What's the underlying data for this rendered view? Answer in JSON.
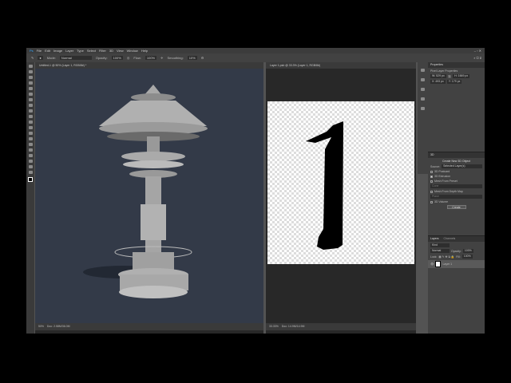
{
  "menu": [
    "File",
    "Edit",
    "Image",
    "Layer",
    "Type",
    "Select",
    "Filter",
    "3D",
    "View",
    "Window",
    "Help"
  ],
  "options": {
    "mode_label": "Mode:",
    "mode": "Normal",
    "opacity_label": "Opacity:",
    "opacity": "100%",
    "flow_label": "Flow:",
    "flow": "100%",
    "smoothing_label": "Smoothing:",
    "smoothing": "10%"
  },
  "doc1": {
    "tab": "Untitled-1 @ 50% (Layer 1, RGB/8#) *",
    "zoom": "50%",
    "doc_size": "Doc: 2.58M/36.0M"
  },
  "doc2": {
    "tab": "Layer 1.psb @ 33.3% (Layer 1, RGB/8#)",
    "zoom": "33.33%",
    "doc_size": "Doc: 14.9M/14.9M"
  },
  "properties": {
    "title": "Properties",
    "subtitle": "Pixel Layer Properties",
    "w": "W: 529 px",
    "h": "H: 1669 px",
    "x": "X: 493 px",
    "y": "Y: 179 px"
  },
  "three_d": {
    "title": "3D",
    "heading": "Create New 3D Object",
    "source_label": "Source:",
    "source": "Selected Layer(s)",
    "options": [
      "3D Postcard",
      "3D Extrusion",
      "Mesh From Preset",
      "Mesh From Depth Map",
      "3D Volume"
    ],
    "preset": "Cone",
    "depth": "Plane",
    "create": "Create"
  },
  "layers": {
    "tabs": [
      "Layers",
      "Channels"
    ],
    "kind": "Kind",
    "blend": "Normal",
    "opacity_label": "Opacity:",
    "opacity": "100%",
    "lock_label": "Lock:",
    "fill_label": "Fill:",
    "fill": "100%",
    "layer_name": "Layer 1"
  }
}
